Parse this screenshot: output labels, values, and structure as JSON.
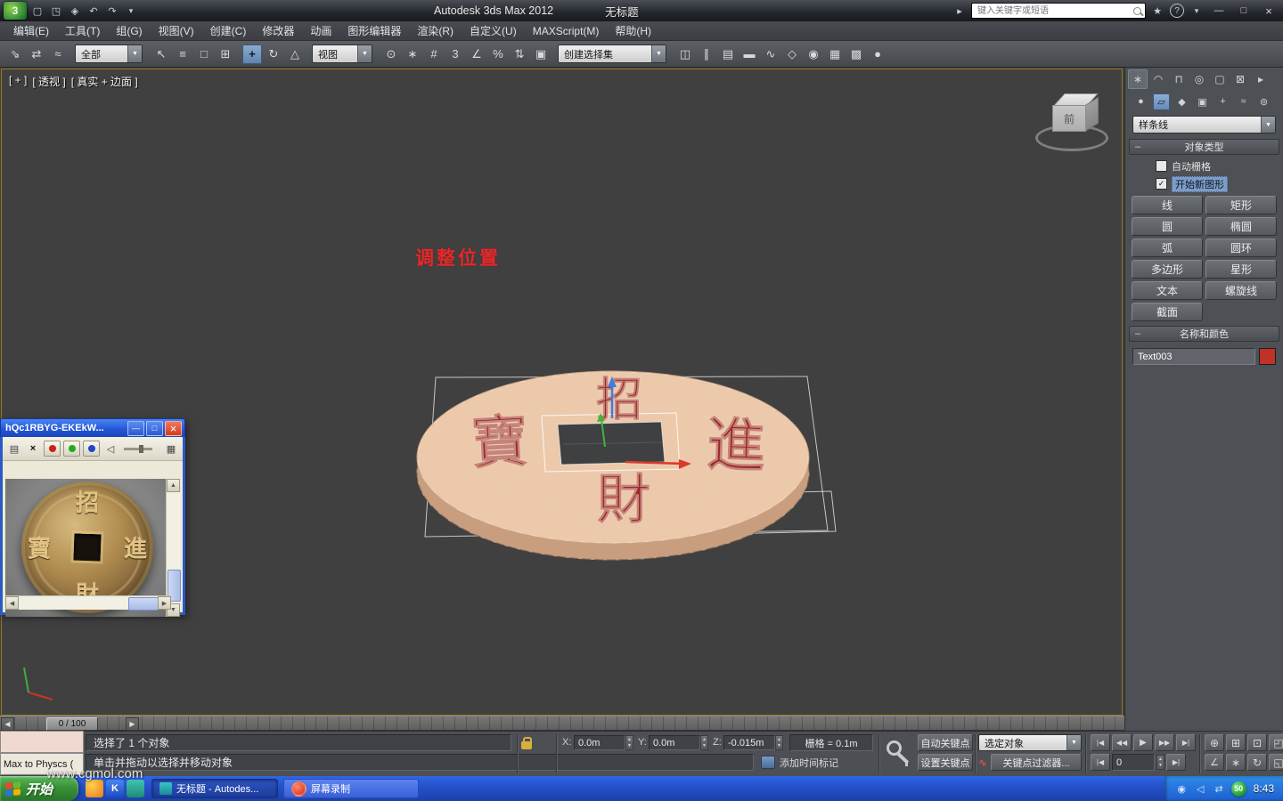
{
  "title_bar": {
    "app_title": "Autodesk 3ds Max  2012",
    "doc_title": "无标题",
    "search_placeholder": "键入关键字或短语"
  },
  "menus": [
    "编辑(E)",
    "工具(T)",
    "组(G)",
    "视图(V)",
    "创建(C)",
    "修改器",
    "动画",
    "图形编辑器",
    "渲染(R)",
    "自定义(U)",
    "MAXScript(M)",
    "帮助(H)"
  ],
  "toolbar": {
    "filter_dropdown": "全部",
    "ref_dropdown": "视图",
    "sets_dropdown": "创建选择集",
    "group1": [
      {
        "name": "select-link-icon",
        "glyph": "⇘"
      },
      {
        "name": "unlink-selection-icon",
        "glyph": "⇄"
      },
      {
        "name": "bind-to-spacewarp-icon",
        "glyph": "≈"
      }
    ],
    "group2": [
      {
        "name": "select-object-icon",
        "glyph": "↖"
      },
      {
        "name": "select-by-name-icon",
        "glyph": "≡"
      },
      {
        "name": "rect-selection-region-icon",
        "glyph": "□"
      },
      {
        "name": "window-crossing-icon",
        "glyph": "⊞"
      }
    ],
    "group3": [
      {
        "name": "select-move-icon",
        "glyph": "+",
        "cls": "active"
      },
      {
        "name": "select-rotate-icon",
        "glyph": "↻"
      },
      {
        "name": "select-scale-icon",
        "glyph": "△"
      }
    ],
    "group4": [
      {
        "name": "use-pivot-center-icon",
        "glyph": "⊙"
      },
      {
        "name": "select-manipulate-icon",
        "glyph": "∗"
      },
      {
        "name": "keyboard-override-icon",
        "glyph": "#"
      },
      {
        "name": "snap-toggle-3d-icon",
        "glyph": "3"
      },
      {
        "name": "angle-snap-icon",
        "glyph": "∠"
      },
      {
        "name": "percent-snap-icon",
        "glyph": "%"
      },
      {
        "name": "spinner-snap-icon",
        "glyph": "⇅"
      },
      {
        "name": "edit-named-sets-icon",
        "glyph": "▣"
      }
    ],
    "group5": [
      {
        "name": "mirror-icon",
        "glyph": "◫"
      },
      {
        "name": "align-icon",
        "glyph": "∥"
      },
      {
        "name": "layer-manager-icon",
        "glyph": "▤"
      },
      {
        "name": "ribbon-toggle-icon",
        "glyph": "▬"
      },
      {
        "name": "curve-editor-icon",
        "glyph": "∿"
      },
      {
        "name": "schematic-view-icon",
        "glyph": "◇"
      },
      {
        "name": "material-editor-icon",
        "glyph": "◉"
      },
      {
        "name": "render-setup-icon",
        "glyph": "▦"
      },
      {
        "name": "rendered-frame-icon",
        "glyph": "▩"
      },
      {
        "name": "render-production-icon",
        "glyph": "●"
      }
    ]
  },
  "viewport": {
    "label_plus": "[ + ]",
    "label_view": "[ 透视 ]",
    "label_shading": "[ 真实 + 边面 ]",
    "annotation": "调整位置"
  },
  "scene": {
    "char_top": "招",
    "char_left": "寶",
    "char_right": "進",
    "char_bottom": "財"
  },
  "viewcube": {
    "front_label": "前"
  },
  "command_panel": {
    "tabs": [
      {
        "name": "create-tab-icon",
        "glyph": "∗",
        "cls": "active"
      },
      {
        "name": "modify-tab-icon",
        "glyph": "◠"
      },
      {
        "name": "hierarchy-tab-icon",
        "glyph": "⊓"
      },
      {
        "name": "motion-tab-icon",
        "glyph": "◎"
      },
      {
        "name": "display-tab-icon",
        "glyph": "▢"
      },
      {
        "name": "utilities-tab-icon",
        "glyph": "⊠"
      },
      {
        "name": "expand-panel-icon",
        "glyph": "▸"
      }
    ],
    "categories": [
      {
        "name": "geometry-category-icon",
        "glyph": "●"
      },
      {
        "name": "shapes-category-icon",
        "glyph": "▱",
        "cls": "active"
      },
      {
        "name": "lights-category-icon",
        "glyph": "◆"
      },
      {
        "name": "cameras-category-icon",
        "glyph": "▣"
      },
      {
        "name": "helpers-category-icon",
        "glyph": "+"
      },
      {
        "name": "spacewarps-category-icon",
        "glyph": "≈"
      },
      {
        "name": "systems-category-icon",
        "glyph": "⊚"
      }
    ],
    "object_dropdown": "样条线",
    "object_type_rollout": "对象类型",
    "autogrid_label": "自动栅格",
    "start_new_shape_label": "开始新图形",
    "shape_buttons": [
      "线",
      "矩形",
      "圆",
      "椭圆",
      "弧",
      "圆环",
      "多边形",
      "星形",
      "文本",
      "螺旋线",
      "截面"
    ],
    "name_color_rollout": "名称和颜色",
    "object_name": "Text003",
    "object_color": "#c03226"
  },
  "player": {
    "title": "hQc1RBYG-EKEkW...",
    "coin_char_top": "招",
    "coin_char_right": "進",
    "coin_char_bottom": "財",
    "coin_char_left": "寶"
  },
  "timeline": {
    "frame_label": "0 / 100"
  },
  "status": {
    "selection_text": "选择了 1 个对象",
    "prompt_text": "单击并拖动以选择并移动对象",
    "add_time_tag": "添加时间标记",
    "x_label": "X:",
    "x_value": "0.0m",
    "y_label": "Y:",
    "y_value": "0.0m",
    "z_label": "Z:",
    "z_value": "-0.015m",
    "grid_text": "栅格 = 0.1m",
    "auto_key_label": "自动关键点",
    "set_key_label": "设置关键点",
    "selection_filter": "选定对象",
    "key_filters_label": "关键点过滤器...",
    "frame_value": "0"
  },
  "overlay": {
    "window_title": "Max to Physcs (",
    "watermark": "www.cgmol.com"
  },
  "taskbar": {
    "start_label": "开始",
    "task1_label": "无标题 - Autodes...",
    "task2_label": "屏幕录制",
    "tray_badge": "50",
    "tray_time": "8:43"
  }
}
